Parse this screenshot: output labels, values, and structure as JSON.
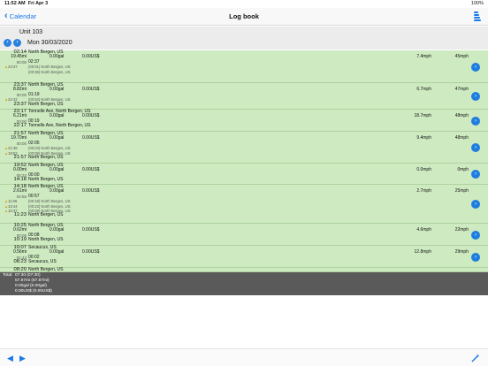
{
  "status": {
    "time": "11:52 AM",
    "date": "Fri Apr 3",
    "battery": "100%"
  },
  "nav": {
    "back_label": "Calendar",
    "title": "Log book"
  },
  "unit": {
    "label": "Unit 103",
    "date": "Mon 30/03/2020"
  },
  "trips": [
    {
      "start": "02:14",
      "start_loc": "North Bergen, US",
      "dist": "19.45mi",
      "fuel": "0.00gal",
      "cost": "0.00US$",
      "speed": "7.4mph",
      "max": "45mph",
      "dur": "00:00",
      "idle": "02:37",
      "subs": [
        "(00:01) North Bergen, US",
        "(00:36) North Bergen, US"
      ],
      "warns": [
        "23:37"
      ]
    },
    {
      "start": "23:37",
      "start_loc": "North Bergen, US",
      "end": "23:37",
      "end_loc": "North Bergen, US",
      "dist": "8.82mi",
      "fuel": "0.00gal",
      "cost": "0.00US$",
      "speed": "6.7mph",
      "max": "47mph",
      "dur": "00:00",
      "idle": "01:19",
      "subs": [
        "(00:54) North Bergen, US"
      ],
      "warns": [
        "22:42"
      ]
    },
    {
      "start": "22:17",
      "start_loc": "Tonnelle Ave, North Bergen, US",
      "end": "22:17",
      "end_loc": "Tonnelle Ave, North Bergen, US",
      "dist": "6.21mi",
      "fuel": "0.00gal",
      "cost": "0.00US$",
      "speed": "18.7mph",
      "max": "48mph",
      "dur": "00:00",
      "idle": "00:19",
      "subs": [],
      "warns": []
    },
    {
      "start": "21:57",
      "start_loc": "North Bergen, US",
      "end": "21:57",
      "end_loc": "North Bergen, US",
      "dist": "19.70mi",
      "fuel": "0.00gal",
      "cost": "0.00US$",
      "speed": "9.4mph",
      "max": "48mph",
      "dur": "00:00",
      "idle": "02:05",
      "subs": [
        "(00:23) North Bergen, US",
        "(00:09) North Bergen, US"
      ],
      "warns": [
        "21:35",
        "19:52"
      ]
    },
    {
      "start": "19:52",
      "start_loc": "North Bergen, US",
      "end": "14:18",
      "end_loc": "North Bergen, US",
      "dist": "0.00mi",
      "fuel": "0.00gal",
      "cost": "0.00US$",
      "speed": "0.0mph",
      "max": "0mph",
      "dur": "05:33",
      "idle": "00:00",
      "subs": [],
      "warns": []
    },
    {
      "start": "14:18",
      "start_loc": "North Bergen, US",
      "end": "11:23",
      "end_loc": "North Bergen, US",
      "dist": "2.61mi",
      "fuel": "0.00gal",
      "cost": "0.00US$",
      "speed": "2.7mph",
      "max": "25mph",
      "dur": "02:55",
      "idle": "00:57",
      "subs": [
        "(00:18) North Bergen, US",
        "(00:23) North Bergen, US",
        "(00:09) North Bergen, US"
      ],
      "warns": [
        "11:06",
        "10:44",
        "10:37"
      ]
    },
    {
      "start": "10:25",
      "start_loc": "North Bergen, US",
      "end": "10:19",
      "end_loc": "North Bergen, US",
      "dist": "0.62mi",
      "fuel": "0.00gal",
      "cost": "0.00US$",
      "speed": "4.6mph",
      "max": "22mph",
      "dur": "00:06",
      "idle": "00:08",
      "subs": [],
      "warns": []
    },
    {
      "start": "10:07",
      "start_loc": "Secaucus, US",
      "end": "08:23",
      "end_loc": "Secaucus, US",
      "dist": "0.56mi",
      "fuel": "0.00gal",
      "cost": "0.00US$",
      "speed": "12.8mph",
      "max": "29mph",
      "dur": "01:44",
      "idle": "00:02",
      "subs": [],
      "warns": []
    },
    {
      "start": "08:20",
      "start_loc": "North Bergen, US",
      "subs": [],
      "warns": []
    }
  ],
  "total": {
    "label": "Total:",
    "time": "07:30 (07:30)",
    "dist": "57.87mi (57.87mi)",
    "fuel": "0.00gal (0.00gal)",
    "cost": "0.00US$ (0.00US$)"
  },
  "colors": {
    "accent": "#1a7ae6",
    "row_bg": "#cdeac0",
    "total_bg": "#5a5a5a"
  }
}
